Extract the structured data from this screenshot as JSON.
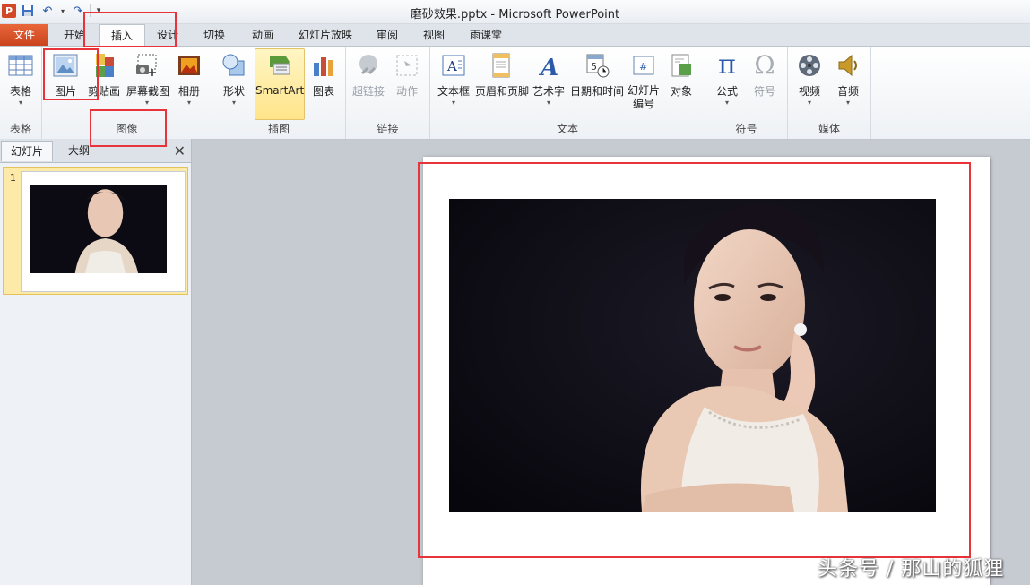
{
  "window": {
    "title": "磨砂效果.pptx  -  Microsoft PowerPoint",
    "app_icon": "P"
  },
  "tabs": [
    "文件",
    "开始",
    "插入",
    "设计",
    "切换",
    "动画",
    "幻灯片放映",
    "审阅",
    "视图",
    "雨课堂"
  ],
  "active_tab": "插入",
  "ribbon": {
    "groups": {
      "tables": "表格",
      "images": "图像",
      "illustrations": "插图",
      "links": "链接",
      "text": "文本",
      "symbols": "符号",
      "media": "媒体"
    },
    "buttons": {
      "table": "表格",
      "picture": "图片",
      "clipart": "剪贴画",
      "screenshot": "屏幕截图",
      "album": "相册",
      "shapes": "形状",
      "smartart": "SmartArt",
      "chart": "图表",
      "hyperlink": "超链接",
      "action": "动作",
      "textbox": "文本框",
      "header_footer": "页眉和页脚",
      "wordart": "艺术字",
      "datetime": "日期和时间",
      "slide_number_1": "幻灯片",
      "slide_number_2": "编号",
      "object": "对象",
      "equation": "公式",
      "symbol": "符号",
      "video": "视频",
      "audio": "音频"
    }
  },
  "left_pane": {
    "tabs": [
      "幻灯片",
      "大纲"
    ],
    "slide_number": "1"
  },
  "watermark": "头条号 / 那山的狐狸",
  "colors": {
    "accent_red": "#e8333a",
    "file_tab": "#d24726",
    "highlight": "#ffe48a"
  }
}
